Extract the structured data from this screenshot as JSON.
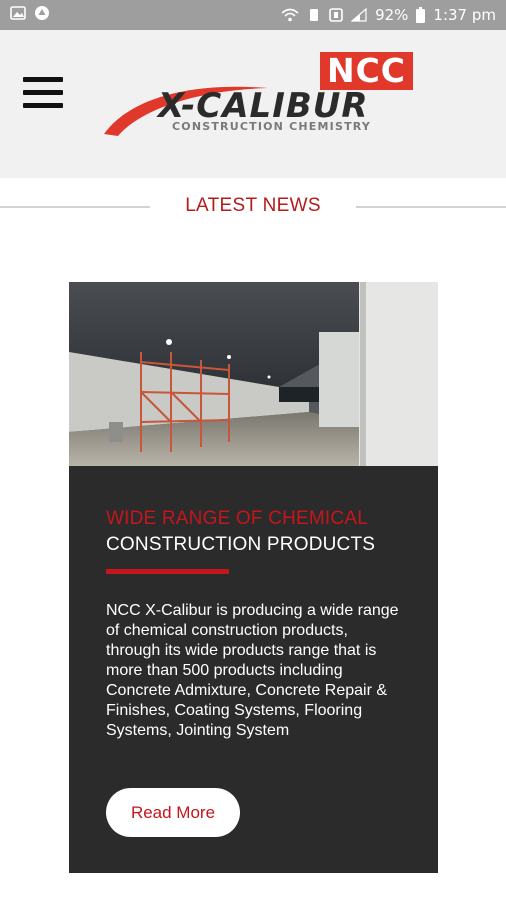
{
  "status_bar": {
    "battery": "92%",
    "time": "1:37 pm",
    "left_icons": [
      "image-icon",
      "drive-icon"
    ],
    "right_icons": [
      "wifi-icon",
      "vibrate-icon",
      "nfc-icon",
      "signal-icon",
      "battery-icon"
    ]
  },
  "header": {
    "menu_icon": "hamburger-icon",
    "logo": {
      "badge": "NCC",
      "wordmark": "X-CALIBUR",
      "tagline": "CONSTRUCTION CHEMISTRY",
      "accent": "#e0392c"
    }
  },
  "section": {
    "title": "LATEST NEWS"
  },
  "news": {
    "title_line1": "WIDE RANGE OF CHEMICAL",
    "title_line2": "CONSTRUCTION PRODUCTS",
    "body": "NCC X-Calibur is producing a wide range of chemical construction products, through its wide products range that is more than 500 products including Concrete Admixture, Concrete Repair & Finishes, Coating Systems, Flooring Systems, Jointing System",
    "button_label": "Read More"
  },
  "colors": {
    "brand_red": "#c4161c",
    "card_bg": "#2b2b2b",
    "header_bg": "#f1f1f1",
    "status_bg": "#9e9e9e"
  }
}
